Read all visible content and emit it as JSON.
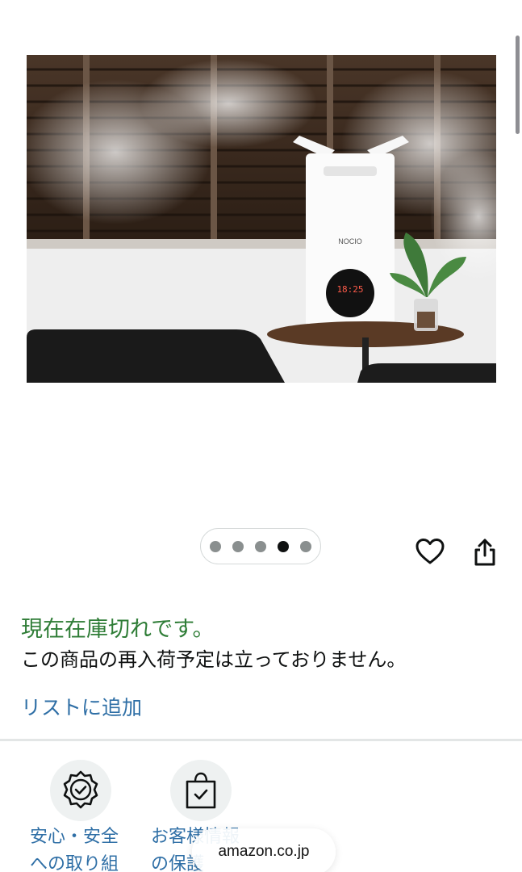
{
  "gallery": {
    "image_alt": "NOCIO humidifier",
    "brand_on_device": "NOCIO",
    "display_reading": "18:25",
    "dots_count": 5,
    "active_index": 3
  },
  "availability": {
    "status": "現在在庫切れです。",
    "restock_note": "この商品の再入荷予定は立っておりません。"
  },
  "actions": {
    "add_to_list": "リストに追加"
  },
  "badges": [
    {
      "line1": "安心・安全",
      "line2": "への取り組",
      "icon": "shield-check-icon"
    },
    {
      "line1": "お客様情報",
      "line2": "の保護",
      "icon": "bag-check-icon"
    }
  ],
  "browser": {
    "url": "amazon.co.jp"
  },
  "colors": {
    "in_stock_text": "#2f7d37",
    "link": "#2f6fa6"
  }
}
